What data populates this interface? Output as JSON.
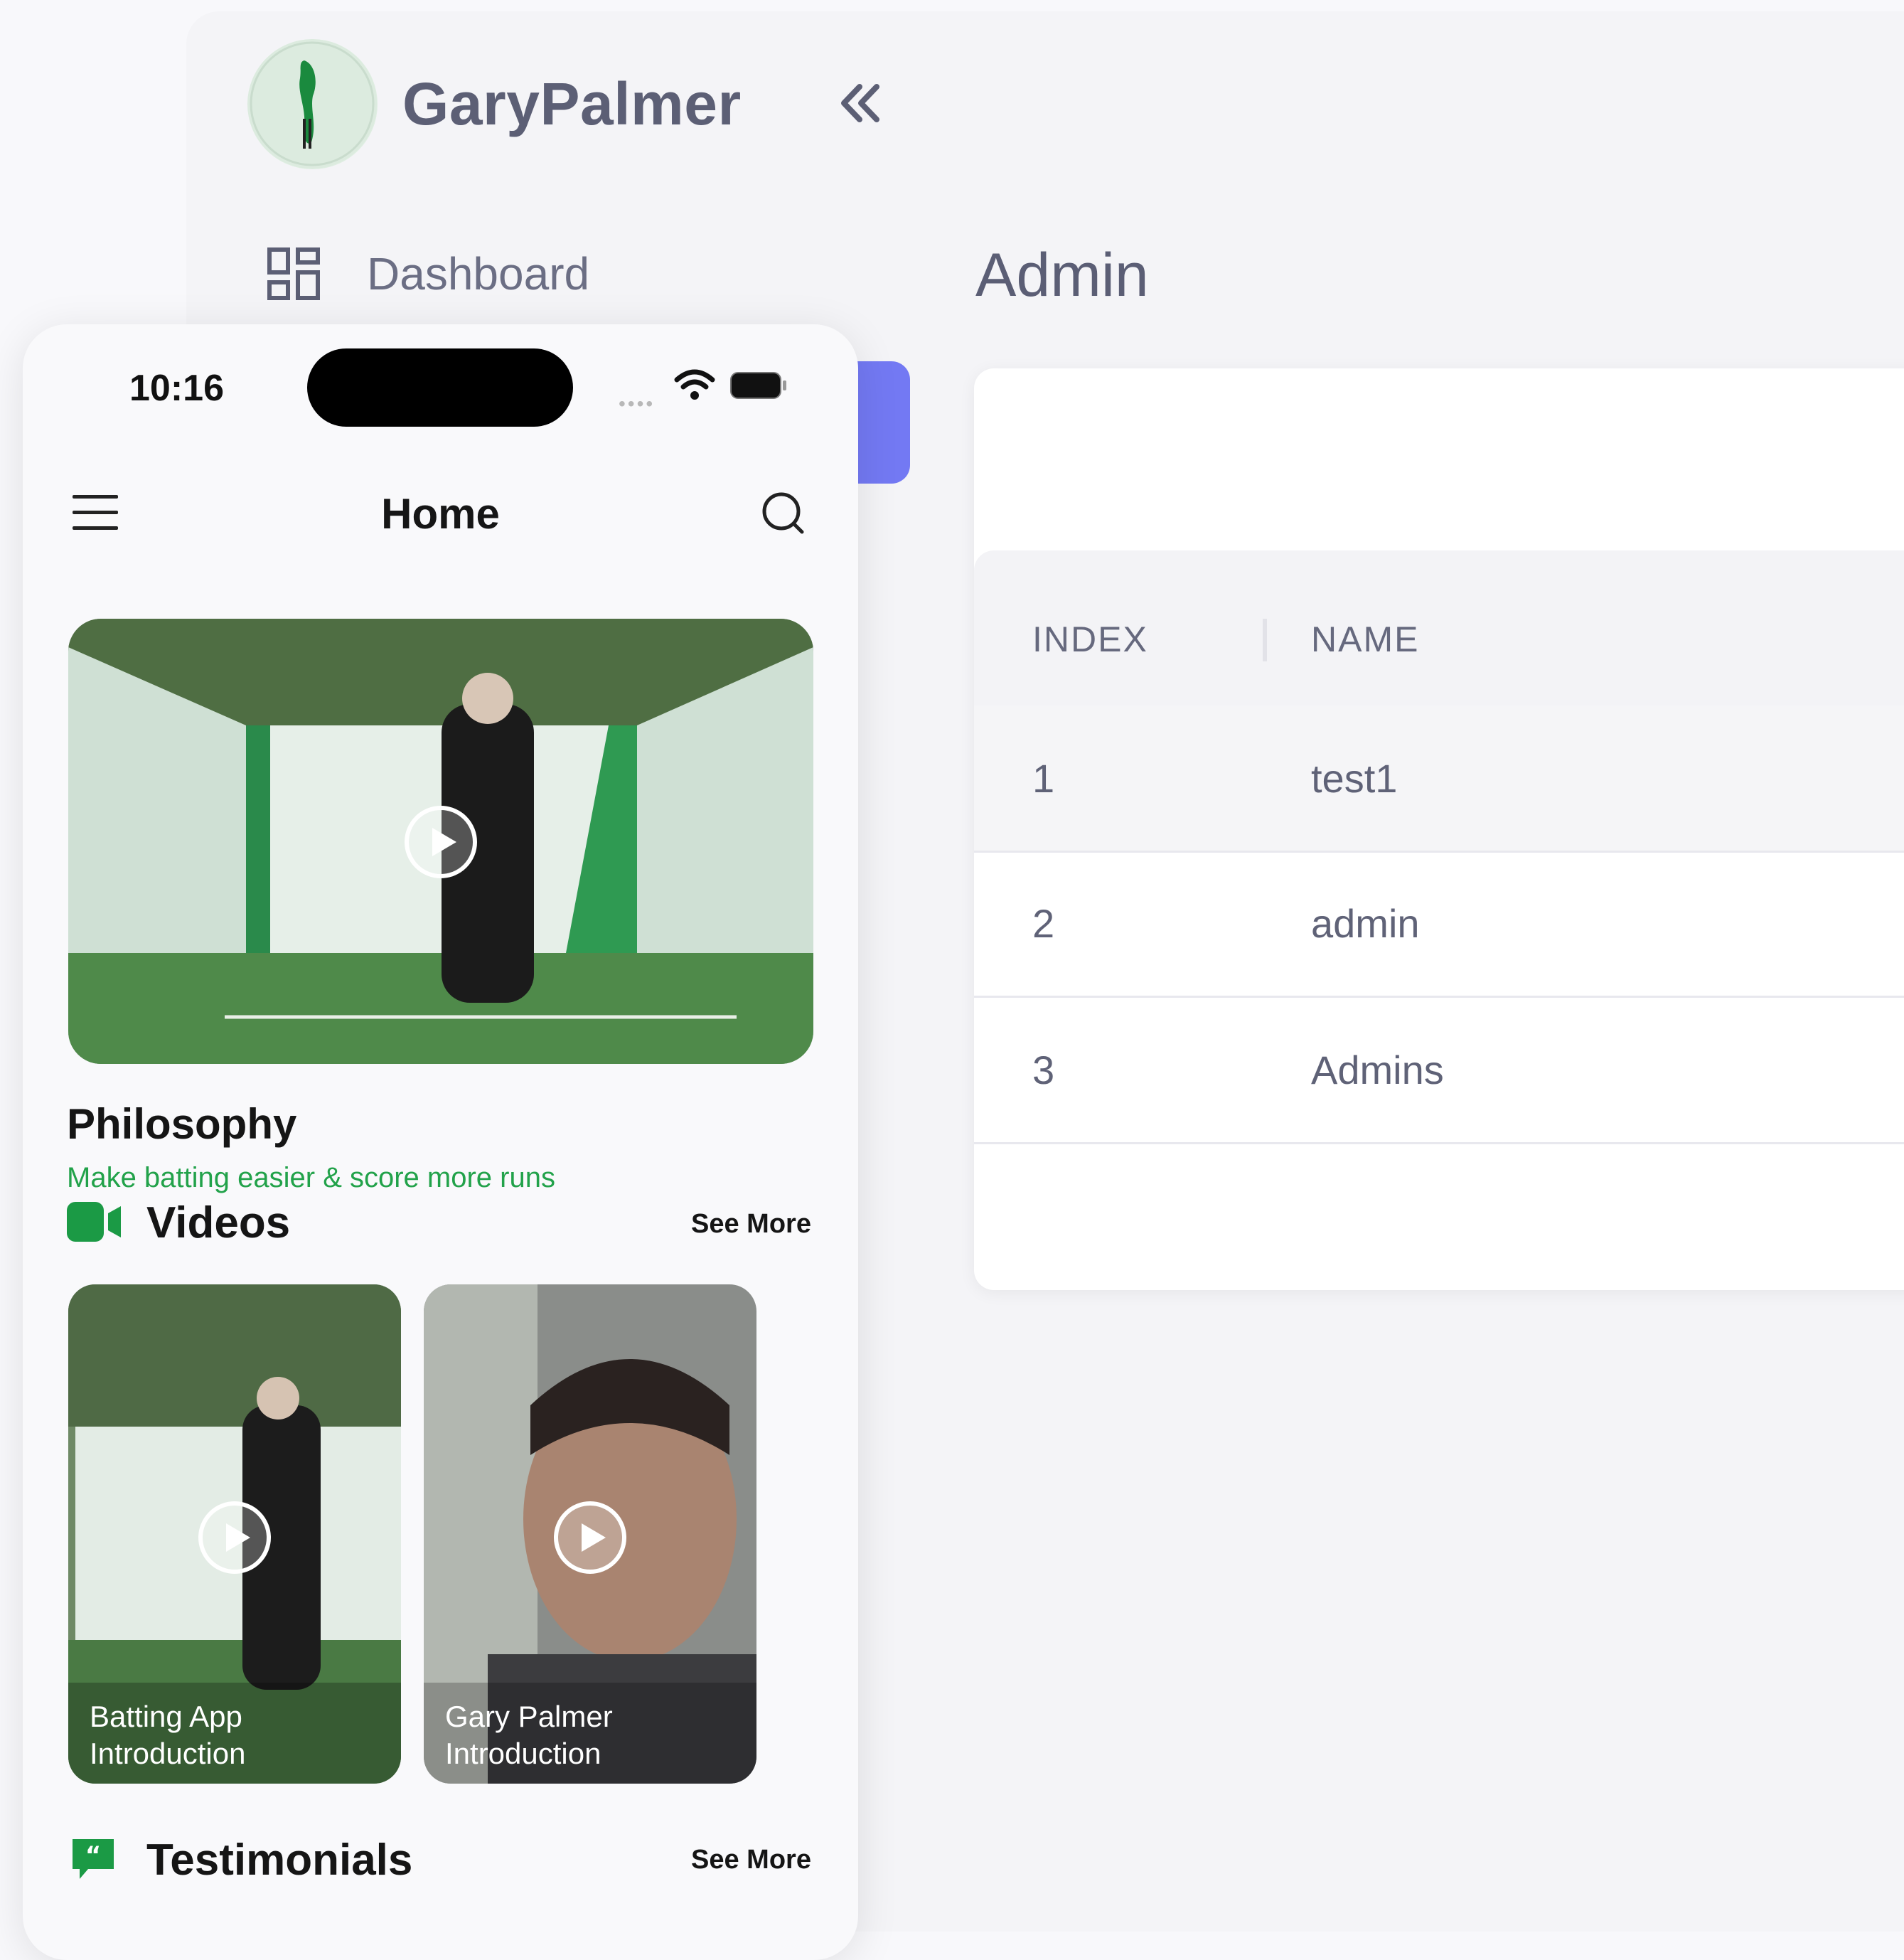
{
  "admin": {
    "brand_name": "GaryPalmer",
    "nav_dashboard_label": "Dashboard",
    "page_title": "Admin",
    "table": {
      "columns": [
        "INDEX",
        "NAME"
      ],
      "rows": [
        {
          "index": "1",
          "name": "test1"
        },
        {
          "index": "2",
          "name": "admin"
        },
        {
          "index": "3",
          "name": "Admins"
        }
      ]
    },
    "accent_color": "#7379f3"
  },
  "phone": {
    "status_time": "10:16",
    "header_title": "Home",
    "philosophy": {
      "title": "Philosophy",
      "subtitle": "Make batting easier & score more runs"
    },
    "videos": {
      "title": "Videos",
      "see_more": "See More",
      "items": [
        {
          "caption_line1": "Batting App",
          "caption_line2": "Introduction"
        },
        {
          "caption_line1": "Gary Palmer",
          "caption_line2": "Introduction"
        }
      ]
    },
    "testimonials": {
      "title": "Testimonials",
      "see_more": "See More"
    },
    "brand_green": "#1b9a45",
    "icons": [
      "menu-icon",
      "search-icon",
      "play-icon",
      "video-camera-icon",
      "quote-icon",
      "wifi-icon",
      "battery-icon"
    ]
  }
}
